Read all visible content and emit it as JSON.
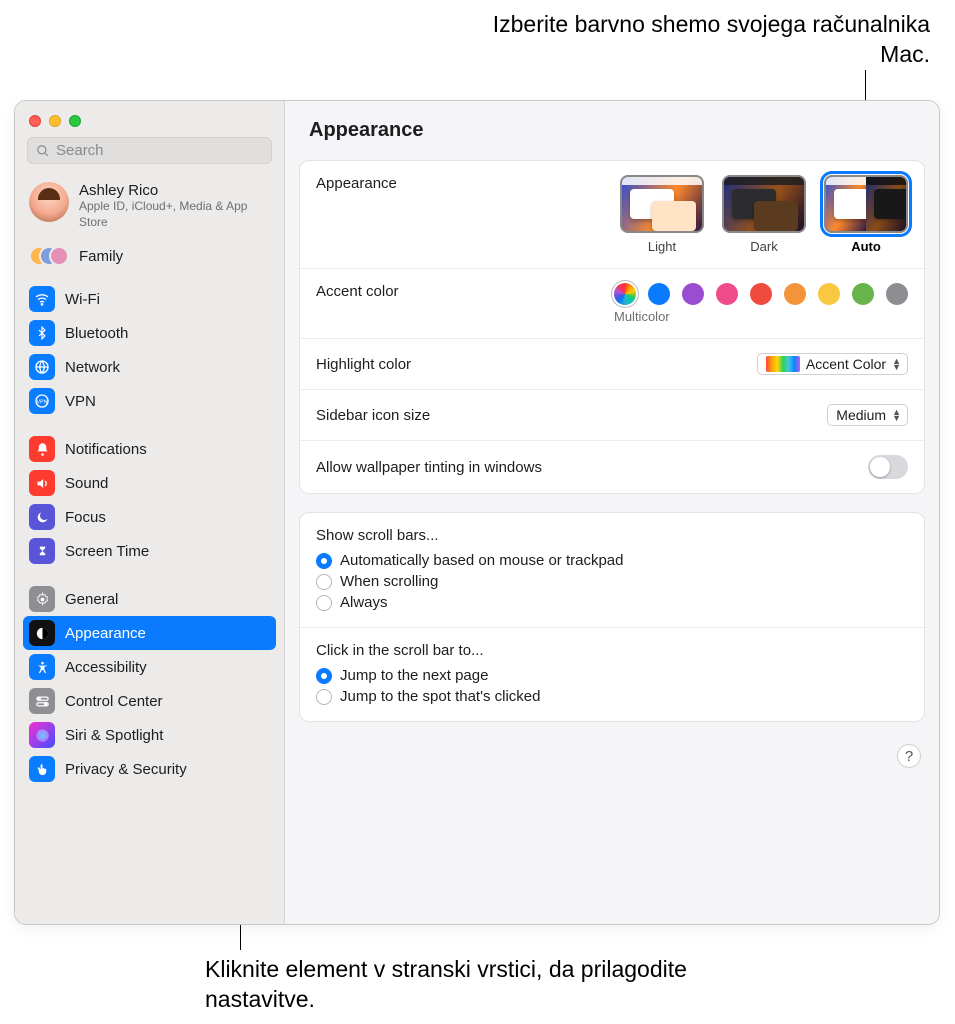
{
  "callouts": {
    "top": "Izberite barvno shemo svojega računalnika Mac.",
    "bottom": "Kliknite element v stranski vrstici, da prilagodite nastavitve."
  },
  "search": {
    "placeholder": "Search"
  },
  "user": {
    "name": "Ashley Rico",
    "sub": "Apple ID, iCloud+, Media & App Store"
  },
  "family_label": "Family",
  "sidebar": {
    "groups": [
      [
        {
          "label": "Wi-Fi",
          "icon": "wifi",
          "cls": "ic-blue"
        },
        {
          "label": "Bluetooth",
          "icon": "bluetooth",
          "cls": "ic-blue"
        },
        {
          "label": "Network",
          "icon": "globe",
          "cls": "ic-blue"
        },
        {
          "label": "VPN",
          "icon": "vpn",
          "cls": "ic-blue"
        }
      ],
      [
        {
          "label": "Notifications",
          "icon": "bell",
          "cls": "ic-red"
        },
        {
          "label": "Sound",
          "icon": "sound",
          "cls": "ic-red"
        },
        {
          "label": "Focus",
          "icon": "moon",
          "cls": "ic-purple"
        },
        {
          "label": "Screen Time",
          "icon": "hourglass",
          "cls": "ic-purple"
        }
      ],
      [
        {
          "label": "General",
          "icon": "gear",
          "cls": "ic-gray"
        },
        {
          "label": "Appearance",
          "icon": "appearance",
          "cls": "ic-black",
          "selected": true
        },
        {
          "label": "Accessibility",
          "icon": "accessibility",
          "cls": "ic-blue"
        },
        {
          "label": "Control Center",
          "icon": "switches",
          "cls": "ic-gray"
        },
        {
          "label": "Siri & Spotlight",
          "icon": "siri",
          "cls": "ic-grad"
        },
        {
          "label": "Privacy & Security",
          "icon": "hand",
          "cls": "ic-blue"
        }
      ]
    ]
  },
  "main": {
    "title": "Appearance",
    "appearance_label": "Appearance",
    "thumbs": [
      {
        "label": "Light",
        "mode": "light"
      },
      {
        "label": "Dark",
        "mode": "dark"
      },
      {
        "label": "Auto",
        "mode": "auto",
        "selected": true
      }
    ],
    "accent_label": "Accent color",
    "accent_caption": "Multicolor",
    "accent_colors": [
      {
        "name": "multicolor",
        "hex": "multi",
        "selected": true
      },
      {
        "name": "blue",
        "hex": "#0a7bff"
      },
      {
        "name": "purple",
        "hex": "#9a4dd0"
      },
      {
        "name": "pink",
        "hex": "#ef4c8a"
      },
      {
        "name": "red",
        "hex": "#ef4b3f"
      },
      {
        "name": "orange",
        "hex": "#f3933a"
      },
      {
        "name": "yellow",
        "hex": "#f9c740"
      },
      {
        "name": "green",
        "hex": "#67b54a"
      },
      {
        "name": "graphite",
        "hex": "#8e8e92"
      }
    ],
    "highlight_label": "Highlight color",
    "highlight_value": "Accent Color",
    "sidebar_size_label": "Sidebar icon size",
    "sidebar_size_value": "Medium",
    "tinting_label": "Allow wallpaper tinting in windows",
    "tinting_on": false,
    "scrollbars": {
      "title": "Show scroll bars...",
      "options": [
        {
          "label": "Automatically based on mouse or trackpad",
          "on": true
        },
        {
          "label": "When scrolling",
          "on": false
        },
        {
          "label": "Always",
          "on": false
        }
      ]
    },
    "click": {
      "title": "Click in the scroll bar to...",
      "options": [
        {
          "label": "Jump to the next page",
          "on": true
        },
        {
          "label": "Jump to the spot that's clicked",
          "on": false
        }
      ]
    },
    "help": "?"
  }
}
